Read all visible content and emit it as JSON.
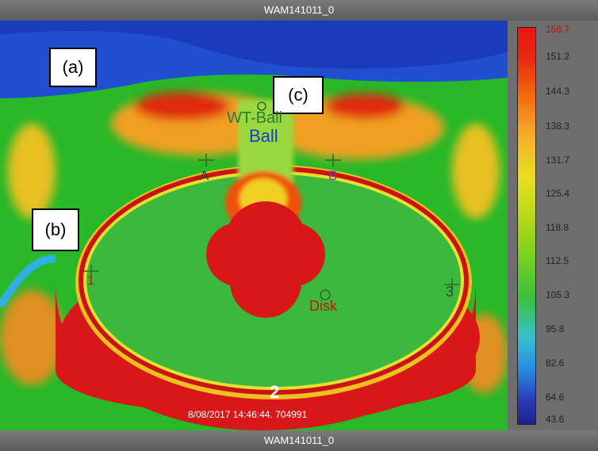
{
  "window": {
    "title_top": "WAM141011_0",
    "title_bottom": "WAM141011_0"
  },
  "panels": {
    "a": "(a)",
    "b": "(b)",
    "c": "(c)"
  },
  "markers": {
    "wt_ball": "WT-Ball",
    "ball": "Ball",
    "a": "A",
    "b": "B",
    "one": "1",
    "two": "2",
    "three": "3",
    "disk": "Disk"
  },
  "timestamp": "8/08/2017 14:46:44. 704991",
  "scale": {
    "max": "156.7",
    "ticks": [
      "151.2",
      "144.3",
      "138.3",
      "131.7",
      "125.4",
      "118.8",
      "112.5",
      "105.3",
      "95.8",
      "82.6",
      "64.6"
    ],
    "min": "43.6"
  }
}
